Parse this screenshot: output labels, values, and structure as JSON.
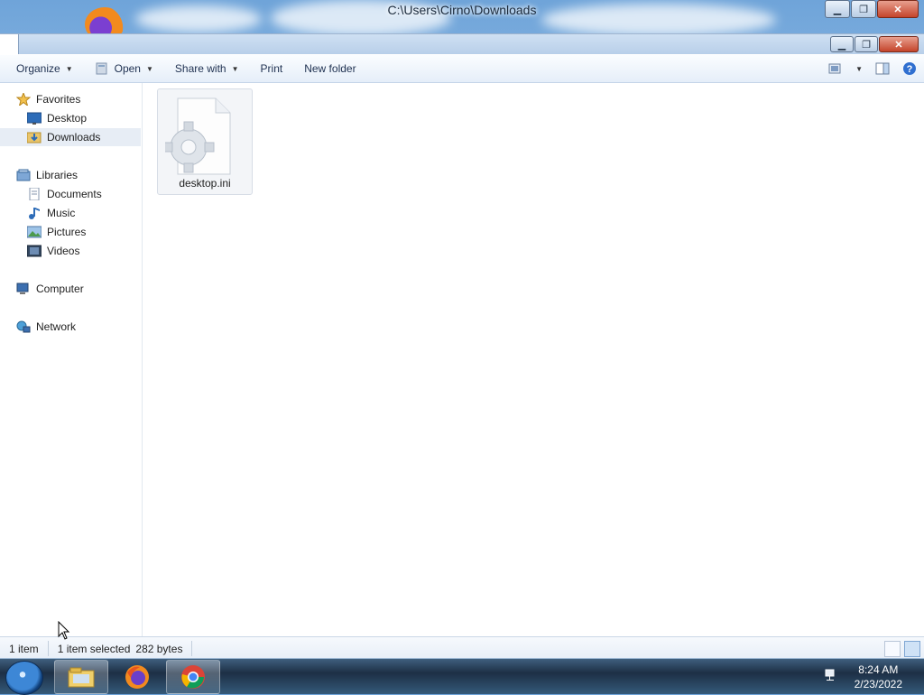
{
  "window": {
    "title": "C:\\Users\\Cirno\\Downloads"
  },
  "toolbar": {
    "organize": "Organize",
    "open": "Open",
    "share_with": "Share with",
    "print": "Print",
    "new_folder": "New folder"
  },
  "nav": {
    "favorites": "Favorites",
    "desktop": "Desktop",
    "downloads": "Downloads",
    "libraries": "Libraries",
    "documents": "Documents",
    "music": "Music",
    "pictures": "Pictures",
    "videos": "Videos",
    "computer": "Computer",
    "network": "Network"
  },
  "files": [
    {
      "name": "desktop.ini",
      "icon": "settings-file-icon"
    }
  ],
  "status": {
    "count": "1 item",
    "selected": "1 item selected",
    "size": "282 bytes"
  },
  "taskbar": {
    "time": "8:24 AM",
    "date": "2/23/2022",
    "apps": [
      "explorer-icon",
      "firefox-icon",
      "chrome-icon"
    ]
  },
  "colors": {
    "selection": "#e7edf5",
    "toolbar_text": "#1e3050",
    "taskbar": "#1d2f45"
  }
}
